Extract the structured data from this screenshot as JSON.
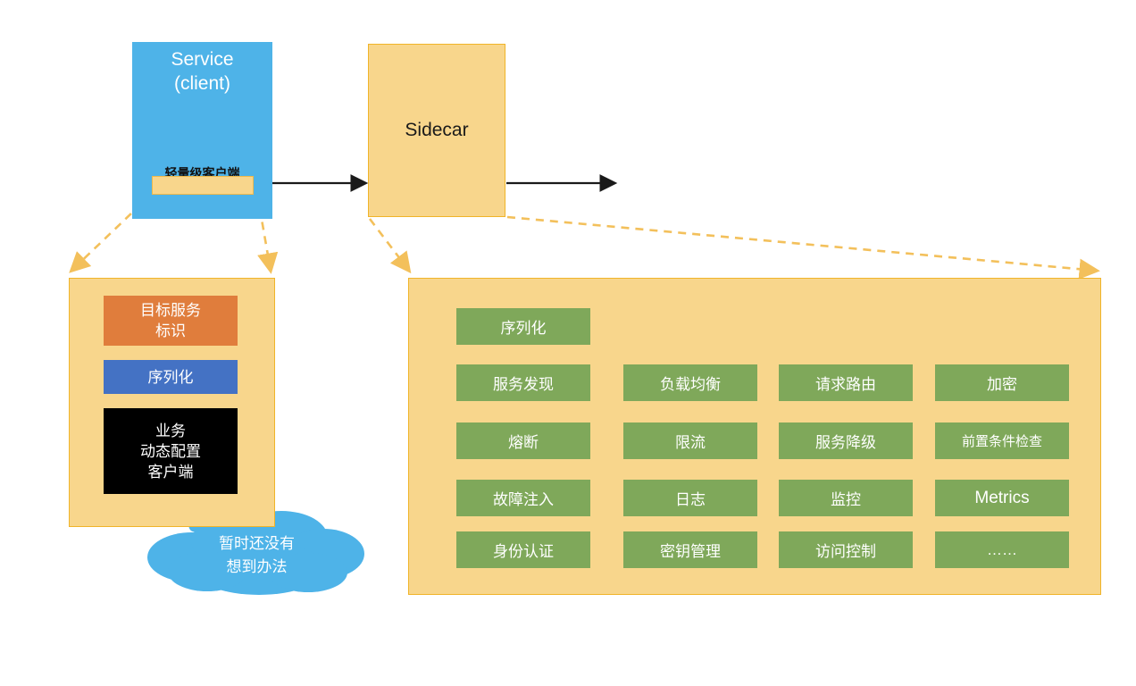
{
  "diagram": {
    "service_box": {
      "title": "Service\n(client)",
      "client_lib_label": "轻量级客户端",
      "bar_name": "client-library-bar",
      "color": "#4eb3e8"
    },
    "sidecar_box": {
      "title": "Sidecar",
      "color": "#f8d68c"
    },
    "client_panel": {
      "items": [
        {
          "label": "目标服务\n标识",
          "color": "#e07d3c"
        },
        {
          "label": "序列化",
          "color": "#4472c4"
        },
        {
          "label": "业务\n动态配置\n客户端",
          "color": "#000000"
        }
      ]
    },
    "cloud": {
      "text": "暂时还没有\n想到办法",
      "color": "#4eb3e8"
    },
    "sidecar_panel": {
      "box_color": "#7fa85a",
      "rows": [
        [
          "序列化"
        ],
        [
          "服务发现",
          "负载均衡",
          "请求路由",
          "加密"
        ],
        [
          "熔断",
          "限流",
          "服务降级",
          "前置条件检查"
        ],
        [
          "故障注入",
          "日志",
          "监控",
          "Metrics"
        ],
        [
          "身份认证",
          "密钥管理",
          "访问控制",
          "……"
        ]
      ]
    },
    "connectors": {
      "flow_arrow_color": "#1a1a1a",
      "dashed_arrow_color": "#f3c05b"
    }
  }
}
